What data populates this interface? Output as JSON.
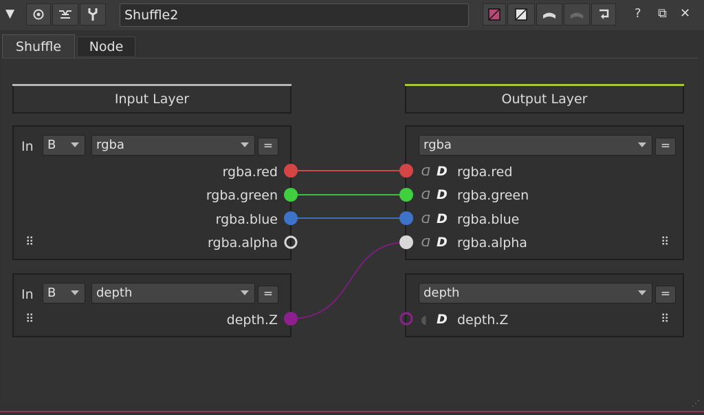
{
  "titlebar": {
    "node_name": "Shuffle2",
    "icons": [
      "collapse-arrow-icon",
      "viewer-icon",
      "node-extract-icon",
      "settings-icon",
      "color-swatch-icon",
      "mask-swatch-icon",
      "undo-icon",
      "redo-icon",
      "revert-icon",
      "help-icon",
      "float-icon",
      "close-icon"
    ],
    "help_glyph": "?",
    "close_glyph": "✕",
    "float_glyph": "⧉"
  },
  "tabs": [
    {
      "label": "Shuffle"
    },
    {
      "label": "Node"
    }
  ],
  "input_layer": {
    "title": "Input Layer",
    "accent": "#b7b7b7",
    "groups": [
      {
        "in_label": "In",
        "source": "B",
        "layer": "rgba",
        "eq": "=",
        "channels": [
          {
            "name": "rgba.red",
            "color": "#d64545",
            "connected": true
          },
          {
            "name": "rgba.green",
            "color": "#3fcf3f",
            "connected": true
          },
          {
            "name": "rgba.blue",
            "color": "#3d73c9",
            "connected": true
          },
          {
            "name": "rgba.alpha",
            "color": "#d8d8d8",
            "connected": false
          }
        ]
      },
      {
        "in_label": "In",
        "source": "B",
        "layer": "depth",
        "eq": "=",
        "channels": [
          {
            "name": "depth.Z",
            "color": "#8f1f8f",
            "connected": true
          }
        ]
      }
    ]
  },
  "output_layer": {
    "title": "Output Layer",
    "accent": "#a6c93c",
    "groups": [
      {
        "layer": "rgba",
        "eq": "=",
        "channels": [
          {
            "name": "rgba.red",
            "color": "#d64545"
          },
          {
            "name": "rgba.green",
            "color": "#3fcf3f"
          },
          {
            "name": "rgba.blue",
            "color": "#3d73c9"
          },
          {
            "name": "rgba.alpha",
            "color": "#d8d8d8"
          }
        ]
      },
      {
        "layer": "depth",
        "eq": "=",
        "channels": [
          {
            "name": "depth.Z",
            "color": "#8f1f8f"
          }
        ]
      }
    ]
  },
  "wire_colors": {
    "red": "#c94a4a",
    "green": "#3fbf3f",
    "blue": "#3b6fbf",
    "purple": "#7a1f7a"
  },
  "glyphs": {
    "write": "D",
    "grip": "⠿"
  }
}
